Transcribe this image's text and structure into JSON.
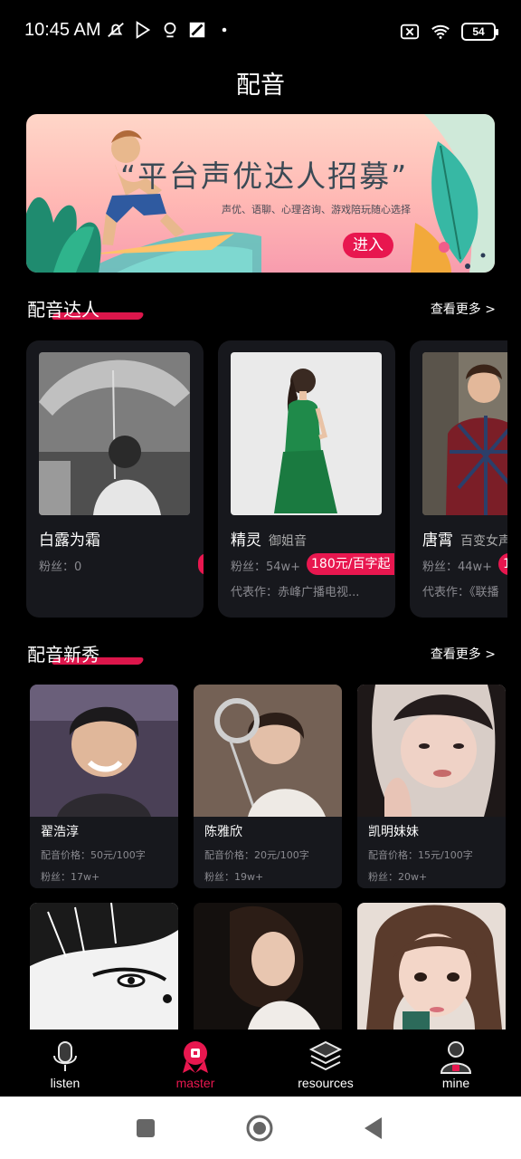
{
  "status": {
    "time": "10:45 AM",
    "battery": "54"
  },
  "page": {
    "title": "配音"
  },
  "banner": {
    "title": "“平台声优达人招募”",
    "subtitle": "声优、语聊、心理咨询、游戏陪玩随心选择",
    "button": "进入"
  },
  "talent_section": {
    "title": "配音达人",
    "more": "查看更多 >",
    "cards": [
      {
        "name": "白露为霜",
        "voice": "",
        "fans": "粉丝：0",
        "price": "",
        "works": ""
      },
      {
        "name": "精灵",
        "voice": "御姐音",
        "fans": "粉丝：54w+",
        "price": "180元/百字起",
        "works": "代表作：赤峰广播电视..."
      },
      {
        "name": "唐霄",
        "voice": "百变女声",
        "fans": "粉丝：44w+",
        "price": "1",
        "works": "代表作：《联播"
      }
    ]
  },
  "new_section": {
    "title": "配音新秀",
    "more": "查看更多 >",
    "cards": [
      {
        "name": "翟浩淳",
        "price": "配音价格：50元/100字",
        "fans": "粉丝：17w+"
      },
      {
        "name": "陈雅欣",
        "price": "配音价格：20元/100字",
        "fans": "粉丝：19w+"
      },
      {
        "name": "凯明妹妹",
        "price": "配音价格：15元/100字",
        "fans": "粉丝：20w+"
      }
    ]
  },
  "bottom_nav": {
    "items": [
      {
        "label": "listen",
        "icon": "microphone-icon"
      },
      {
        "label": "master",
        "icon": "medal-icon",
        "active": true
      },
      {
        "label": "resources",
        "icon": "layers-icon"
      },
      {
        "label": "mine",
        "icon": "user-icon"
      }
    ]
  },
  "colors": {
    "accent": "#e8174f",
    "card_bg": "#17181d",
    "background": "#000000"
  }
}
